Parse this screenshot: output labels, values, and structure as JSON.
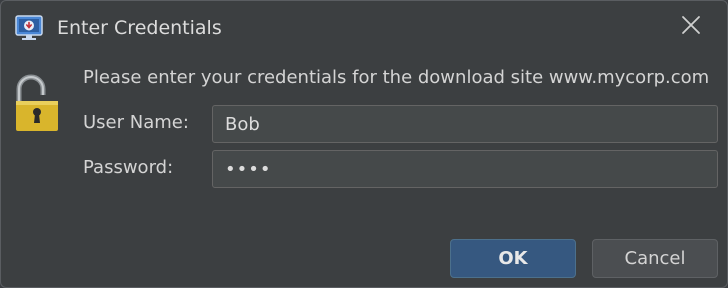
{
  "window": {
    "title": "Enter Credentials",
    "app_icon": "download-monitor-icon",
    "close_icon": "close-icon"
  },
  "body": {
    "lock_icon": "open-padlock-icon",
    "message": "Please enter your credentials for the download site www.mycorp.com",
    "user_label": "User Name:",
    "user_value": "Bob",
    "password_label": "Password:",
    "password_value": "••••"
  },
  "buttons": {
    "ok_label": "OK",
    "cancel_label": "Cancel"
  },
  "colors": {
    "background": "#3c3f41",
    "primary_button": "#365880",
    "field_background": "#45494a"
  }
}
